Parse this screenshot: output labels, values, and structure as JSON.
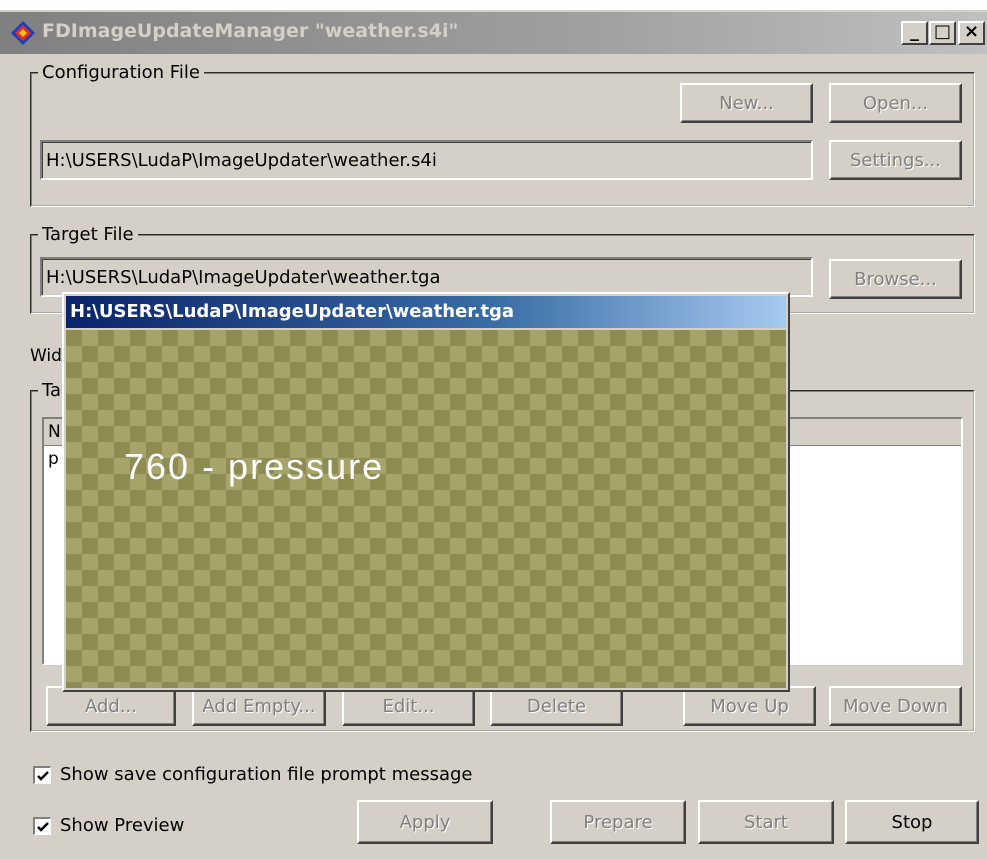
{
  "window": {
    "title": "FDImageUpdateManager \"weather.s4i\"",
    "controls": {
      "minimize": "_",
      "maximize": "□",
      "close": "×"
    }
  },
  "config": {
    "legend": "Configuration File",
    "new_label": "New...",
    "open_label": "Open...",
    "path": "H:\\USERS\\LudaP\\ImageUpdater\\weather.s4i",
    "settings_label": "Settings..."
  },
  "target": {
    "legend": "Target File",
    "path": "H:\\USERS\\LudaP\\ImageUpdater\\weather.tga",
    "browse_label": "Browse..."
  },
  "partial": {
    "width_label": "Wid",
    "group_label": "Ta",
    "list_header": "N",
    "list_row": "p"
  },
  "actions": {
    "add": "Add...",
    "add_empty": "Add Empty...",
    "edit": "Edit...",
    "delete": "Delete",
    "move_up": "Move Up",
    "move_down": "Move Down"
  },
  "options": {
    "show_prompt": "Show save configuration file prompt message",
    "show_preview": "Show Preview"
  },
  "bottom": {
    "apply": "Apply",
    "prepare": "Prepare",
    "start": "Start",
    "stop": "Stop"
  },
  "preview": {
    "title": "H:\\USERS\\LudaP\\ImageUpdater\\weather.tga",
    "text": "760 - pressure"
  }
}
